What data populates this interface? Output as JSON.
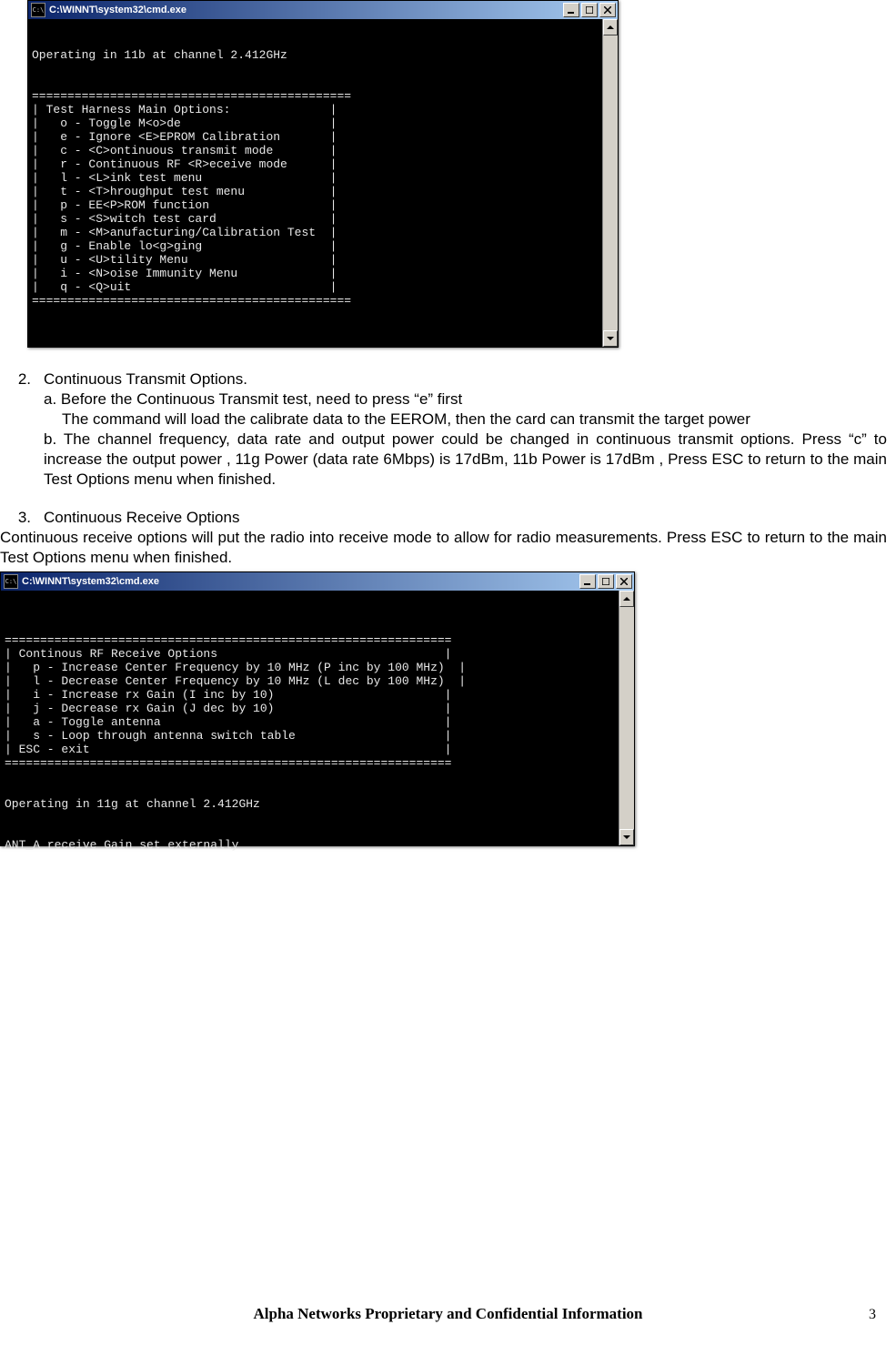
{
  "window1": {
    "title": "C:\\WINNT\\system32\\cmd.exe",
    "icon_label": "C:\\",
    "lines": [
      "Operating in 11b at channel 2.412GHz",
      "",
      "",
      "=============================================",
      "| Test Harness Main Options:              |",
      "|   o - Toggle M<o>de                     |",
      "|   e - Ignore <E>EPROM Calibration       |",
      "|   c - <C>ontinuous transmit mode        |",
      "|   r - Continuous RF <R>eceive mode      |",
      "|   l - <L>ink test menu                  |",
      "|   t - <T>hroughput test menu            |",
      "|   p - EE<P>ROM function                 |",
      "|   s - <S>witch test card                |",
      "|   m - <M>anufacturing/Calibration Test  |",
      "|   g - Enable lo<g>ging                  |",
      "|   u - <U>tility Menu                    |",
      "|   i - <N>oise Immunity Menu             |",
      "|   q - <Q>uit                            |",
      "============================================="
    ]
  },
  "section2": {
    "num": "2.",
    "title": "Continuous Transmit Options.",
    "a_label": "a. Before the Continuous Transmit test, need to press “e” first",
    "a_line2": "The command will load the calibrate data to the EEROM, then the card can transmit the target power",
    "b_line": "b. The channel frequency, data rate and output power could be changed in continuous transmit options. Press “c” to increase the output power , 11g Power (data rate 6Mbps) is 17dBm, 11b Power is 17dBm , Press ESC to return to the main Test Options menu when finished."
  },
  "section3": {
    "num": "3.",
    "title": "Continuous Receive Options",
    "body": "Continuous receive options will put the radio into receive mode to allow for radio measurements. Press ESC to return to the main Test Options menu when finished."
  },
  "window2": {
    "title": "C:\\WINNT\\system32\\cmd.exe",
    "icon_label": "C:\\",
    "lines": [
      "",
      "===============================================================",
      "| Continous RF Receive Options                                |",
      "|   p - Increase Center Frequency by 10 MHz (P inc by 100 MHz)  |",
      "|   l - Decrease Center Frequency by 10 MHz (L dec by 100 MHz)  |",
      "|   i - Increase rx Gain (I inc by 10)                        |",
      "|   j - Decrease rx Gain (J dec by 10)                        |",
      "|   a - Toggle antenna                                        |",
      "|   s - Loop through antenna switch table                     |",
      "| ESC - exit                                                  |",
      "===============================================================",
      "",
      "",
      "Operating in 11g at channel 2.412GHz",
      "",
      "",
      "ANT_A receive Gain set externally"
    ]
  },
  "footer": "Alpha Networks Proprietary and Confidential Information",
  "page_number": "3"
}
